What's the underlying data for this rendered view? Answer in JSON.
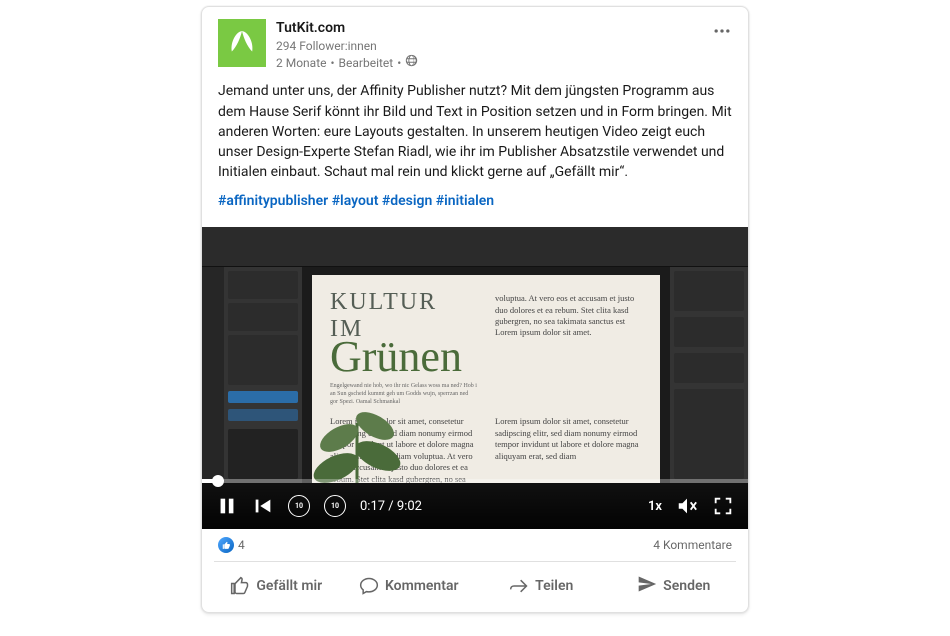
{
  "header": {
    "author_name": "TutKit.com",
    "followers": "294 Follower:innen",
    "time": "2 Monate",
    "edited": "Bearbeitet"
  },
  "body": {
    "text": "Jemand unter uns, der Affinity Publisher nutzt? Mit dem jüngsten Programm aus dem Hause Serif könnt ihr Bild und Text in Position setzen und in Form bringen. Mit anderen Worten: eure Layouts gestalten. In unserem heutigen Video zeigt euch unser Design-Experte Stefan Riadl, wie ihr im Publisher Absatzstile verwendet und Initialen einbaut. Schaut mal rein und klickt gerne auf „Gefällt mir“.",
    "hashtags": [
      "#affinitypublisher",
      "#layout",
      "#design",
      "#initialen"
    ]
  },
  "video": {
    "doc": {
      "headline1": "KULTUR IM",
      "headline2": "Grünen",
      "sub": "Engelgewand nie hob, wo ihr nic Gelass woss ma ned? Hob i an Sun gscheid kummt geh um Godds wujn, sperrzan ned gor Spezi. Oamal Schmankal",
      "lead": "voluptua. At vero eos et accusam et justo duo dolores et ea rebum. Stet clita kasd gubergren, no sea takimata sanctus est Lorem ipsum dolor sit amet.",
      "col1": "Lorem ipsum dolor sit amet, consetetur sadipscing elitr, sed diam nonumy eirmod tempor invidunt ut labore et dolore magna aliquyam erat, sed diam voluptua. At vero eos et accusam et justo duo dolores et ea rebum. Stet clita kasd gubergren, no sea takimata sanctus est Lorem ipsum",
      "col2": "Lorem ipsum dolor sit amet, consetetur sadipscing elitr, sed diam nonumy eirmod tempor invidunt ut labore et dolore magna aliquyam erat, sed diam"
    },
    "controls": {
      "current_time": "0:17",
      "duration": "9:02",
      "speed": "1x",
      "back_seconds": "10",
      "fwd_seconds": "10"
    }
  },
  "stats": {
    "like_count": "4",
    "comments": "4 Kommentare"
  },
  "actions": {
    "like": "Gefällt mir",
    "comment": "Kommentar",
    "share": "Teilen",
    "send": "Senden"
  }
}
